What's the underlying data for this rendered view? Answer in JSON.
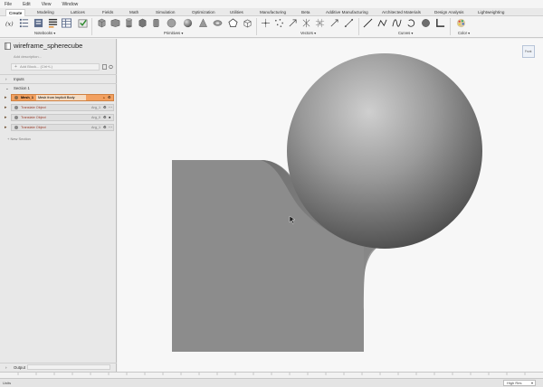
{
  "menu": [
    "File",
    "Edit",
    "View",
    "Window"
  ],
  "tabs": [
    "Create",
    "Modeling",
    "Lattices",
    "Fields",
    "Math",
    "Simulation",
    "Optimization",
    "Utilities",
    "Manufacturing",
    "Beta",
    "Additive Manufacturing",
    "Architected Materials",
    "Design Analysis",
    "Lightweighting"
  ],
  "groups": {
    "notebooks": "Notebooks",
    "primitives": "Primitives",
    "vectors": "Vectors",
    "curves": "Curves",
    "color": "Color"
  },
  "notebook": {
    "title": "wireframe_spherecube",
    "description_placeholder": "Add description...",
    "add_block": "Add Block... (Ctrl+L)",
    "inputs": "Inputs",
    "section": "Section 1",
    "new_section": "+ New Section",
    "output": "Output"
  },
  "blocks": [
    {
      "name": "Mesh_1",
      "op": "Mesh from Implicit Body",
      "badge": "",
      "color": "#f2a060"
    },
    {
      "name": "Translate Object",
      "op": "",
      "badge": "Arg_1",
      "color": "#dedede"
    },
    {
      "name": "Translate Object",
      "op": "",
      "badge": "Arg_0",
      "color": "#dedede"
    },
    {
      "name": "Translate Object",
      "op": "",
      "badge": "Arg_1",
      "color": "#dedede"
    }
  ],
  "view_cube_label": "Front",
  "status": {
    "left": "Units",
    "right": "High Res"
  },
  "ruler_ticks": [
    "0",
    "1",
    "2",
    "3",
    "4",
    "5",
    "6",
    "7",
    "8",
    "9",
    "10",
    "11",
    "12",
    "13",
    "14",
    "15",
    "16",
    "17",
    "18",
    "19",
    "20",
    "21",
    "22",
    "23",
    "24",
    "25",
    "26",
    "27",
    "28",
    "29",
    "30"
  ]
}
